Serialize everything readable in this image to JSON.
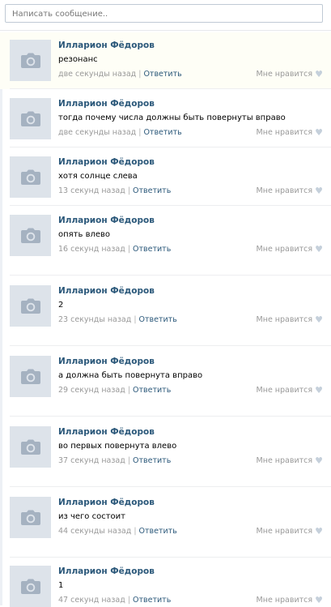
{
  "composer": {
    "placeholder": "Написать сообщение.."
  },
  "comments": [
    {
      "author": "Илларион Фёдоров",
      "text": "резонанс",
      "time": "две секунды назад",
      "reply": "Ответить",
      "like": "Мне нравится"
    },
    {
      "author": "Илларион Фёдоров",
      "text": "тогда почему числа должны быть повернуты вправо",
      "time": "две секунды назад",
      "reply": "Ответить",
      "like": "Мне нравится"
    },
    {
      "author": "Илларион Фёдоров",
      "text": "хотя солнце слева",
      "time": "13 секунд назад",
      "reply": "Ответить",
      "like": "Мне нравится"
    },
    {
      "author": "Илларион Фёдоров",
      "text": "опять влево",
      "time": "16 секунд назад",
      "reply": "Ответить",
      "like": "Мне нравится"
    },
    {
      "author": "Илларион Фёдоров",
      "text": "2",
      "time": "23 секунды назад",
      "reply": "Ответить",
      "like": "Мне нравится"
    },
    {
      "author": "Илларион Фёдоров",
      "text": "а должна быть повернута вправо",
      "time": "29 секунд назад",
      "reply": "Ответить",
      "like": "Мне нравится"
    },
    {
      "author": "Илларион Фёдоров",
      "text": "во первых повернута влево",
      "time": "37 секунд назад",
      "reply": "Ответить",
      "like": "Мне нравится"
    },
    {
      "author": "Илларион Фёдоров",
      "text": "из чего состоит",
      "time": "44 секунды назад",
      "reply": "Ответить",
      "like": "Мне нравится"
    },
    {
      "author": "Илларион Фёдоров",
      "text": "1",
      "time": "47 секунд назад",
      "reply": "Ответить",
      "like": "Мне нравится"
    }
  ]
}
